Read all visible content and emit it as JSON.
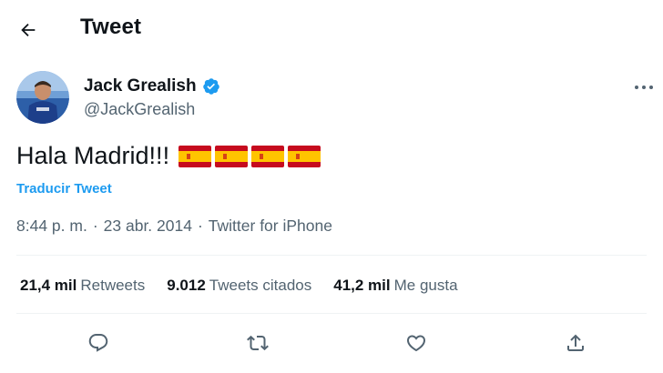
{
  "header": {
    "title": "Tweet"
  },
  "author": {
    "name": "Jack Grealish",
    "handle": "@JackGrealish",
    "verified": true
  },
  "tweet": {
    "text": "Hala Madrid!!!",
    "emoji_flags": [
      "flag-spain-icon",
      "flag-spain-icon",
      "flag-spain-icon",
      "flag-spain-icon"
    ],
    "translate_label": "Traducir Tweet"
  },
  "meta": {
    "time": "8:44 p. m.",
    "separator1": "·",
    "date": "23 abr. 2014",
    "separator2": "·",
    "source": "Twitter for iPhone"
  },
  "stats": [
    {
      "value": "21,4 mil",
      "label": "Retweets"
    },
    {
      "value": "9.012",
      "label": "Tweets citados"
    },
    {
      "value": "41,2 mil",
      "label": "Me gusta"
    }
  ],
  "actions": [
    "reply-icon",
    "retweet-icon",
    "like-icon",
    "share-icon"
  ],
  "colors": {
    "accent": "#1d9bf0",
    "text_primary": "#0f1419",
    "text_secondary": "#536471",
    "divider": "#eff3f4"
  }
}
